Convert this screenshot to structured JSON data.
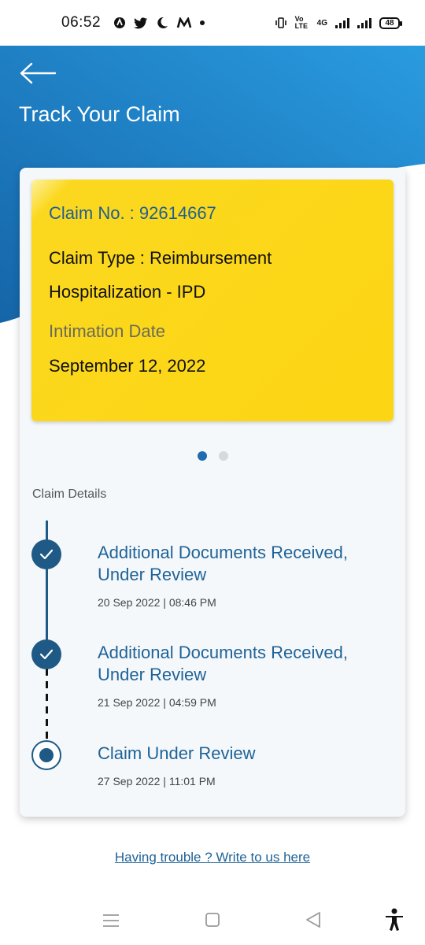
{
  "status_bar": {
    "time": "06:52",
    "battery": "48",
    "network": "4G",
    "volte": "Vo LTE"
  },
  "header": {
    "title": "Track Your Claim",
    "gradient_start": "#1565a8",
    "gradient_end": "#2a9be0"
  },
  "claim": {
    "claim_no_label": "Claim No. :",
    "claim_no": "92614667",
    "claim_no_full": "Claim No. : 92614667",
    "claim_type": "Claim Type : Reimbursement Hospitalization - IPD",
    "intimation_label": "Intimation Date",
    "intimation_date": "September 12, 2022",
    "card_color": "#fcd613"
  },
  "carousel": {
    "pages": 2,
    "active": 1
  },
  "details": {
    "label": "Claim Details",
    "items": [
      {
        "title": "Additional Documents Received, Under Review",
        "time": "20 Sep 2022 | 08:46 PM",
        "status": "done"
      },
      {
        "title": "Additional Documents Received, Under Review",
        "time": "21 Sep 2022 | 04:59 PM",
        "status": "done"
      },
      {
        "title": "Claim Under Review",
        "time": "27 Sep 2022 | 11:01 PM",
        "status": "current"
      }
    ]
  },
  "help_link": "Having trouble ? Write to us here",
  "nav": {
    "icons": [
      "menu-icon",
      "home-square-icon",
      "back-triangle-icon",
      "accessibility-icon"
    ]
  },
  "colors": {
    "accent_blue": "#1f6397",
    "timeline": "#1e5a85"
  }
}
